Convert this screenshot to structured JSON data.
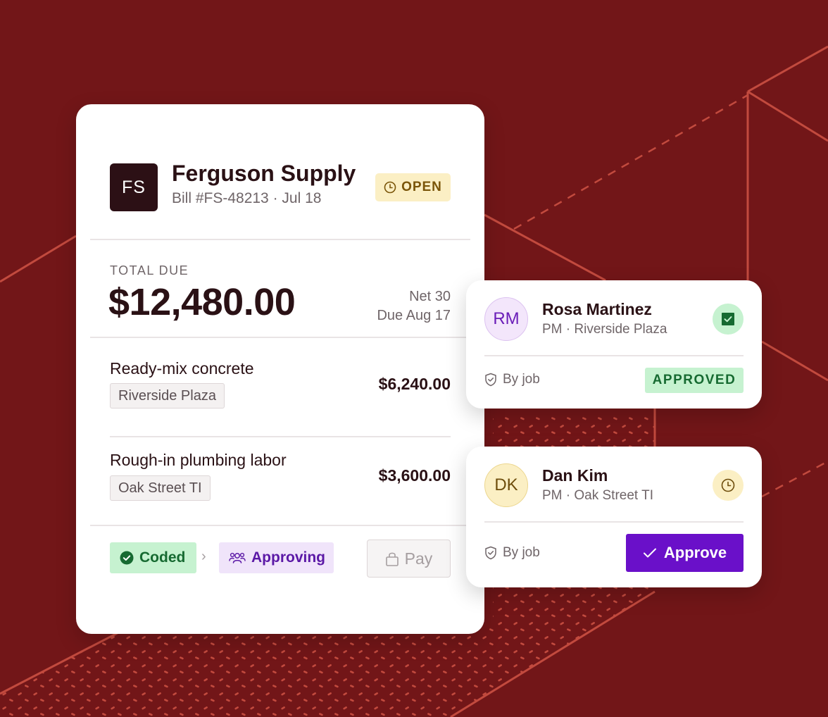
{
  "bill": {
    "vendor_initials": "FS",
    "vendor_name": "Ferguson Supply",
    "bill_meta": "Bill #FS-48213 · Jul 18",
    "status": "OPEN",
    "total_label": "TOTAL DUE",
    "total_amount": "$12,480.00",
    "terms": "Net 30",
    "due_date": "Due Aug 17",
    "line_items": [
      {
        "description": "Ready-mix concrete",
        "job": "Riverside Plaza",
        "amount": "$6,240.00"
      },
      {
        "description": "Rough-in plumbing labor",
        "job": "Oak Street TI",
        "amount": "$3,600.00"
      }
    ],
    "workflow": {
      "coded_label": "Coded",
      "approving_label": "Approving",
      "pay_label": "Pay"
    }
  },
  "approvers": [
    {
      "initials": "RM",
      "name": "Rosa Martinez",
      "role": "PM · Riverside Plaza",
      "rule": "By job",
      "status_label": "APPROVED",
      "status_icon": "checked-box-icon"
    },
    {
      "initials": "DK",
      "name": "Dan Kim",
      "role": "PM · Oak Street TI",
      "rule": "By job",
      "action_label": "Approve",
      "status_icon": "clock-icon"
    }
  ],
  "colors": {
    "background": "#721618",
    "accent_purple": "#6a10c9",
    "success_green": "#166a31",
    "pending_yellow": "#fbefc4"
  }
}
